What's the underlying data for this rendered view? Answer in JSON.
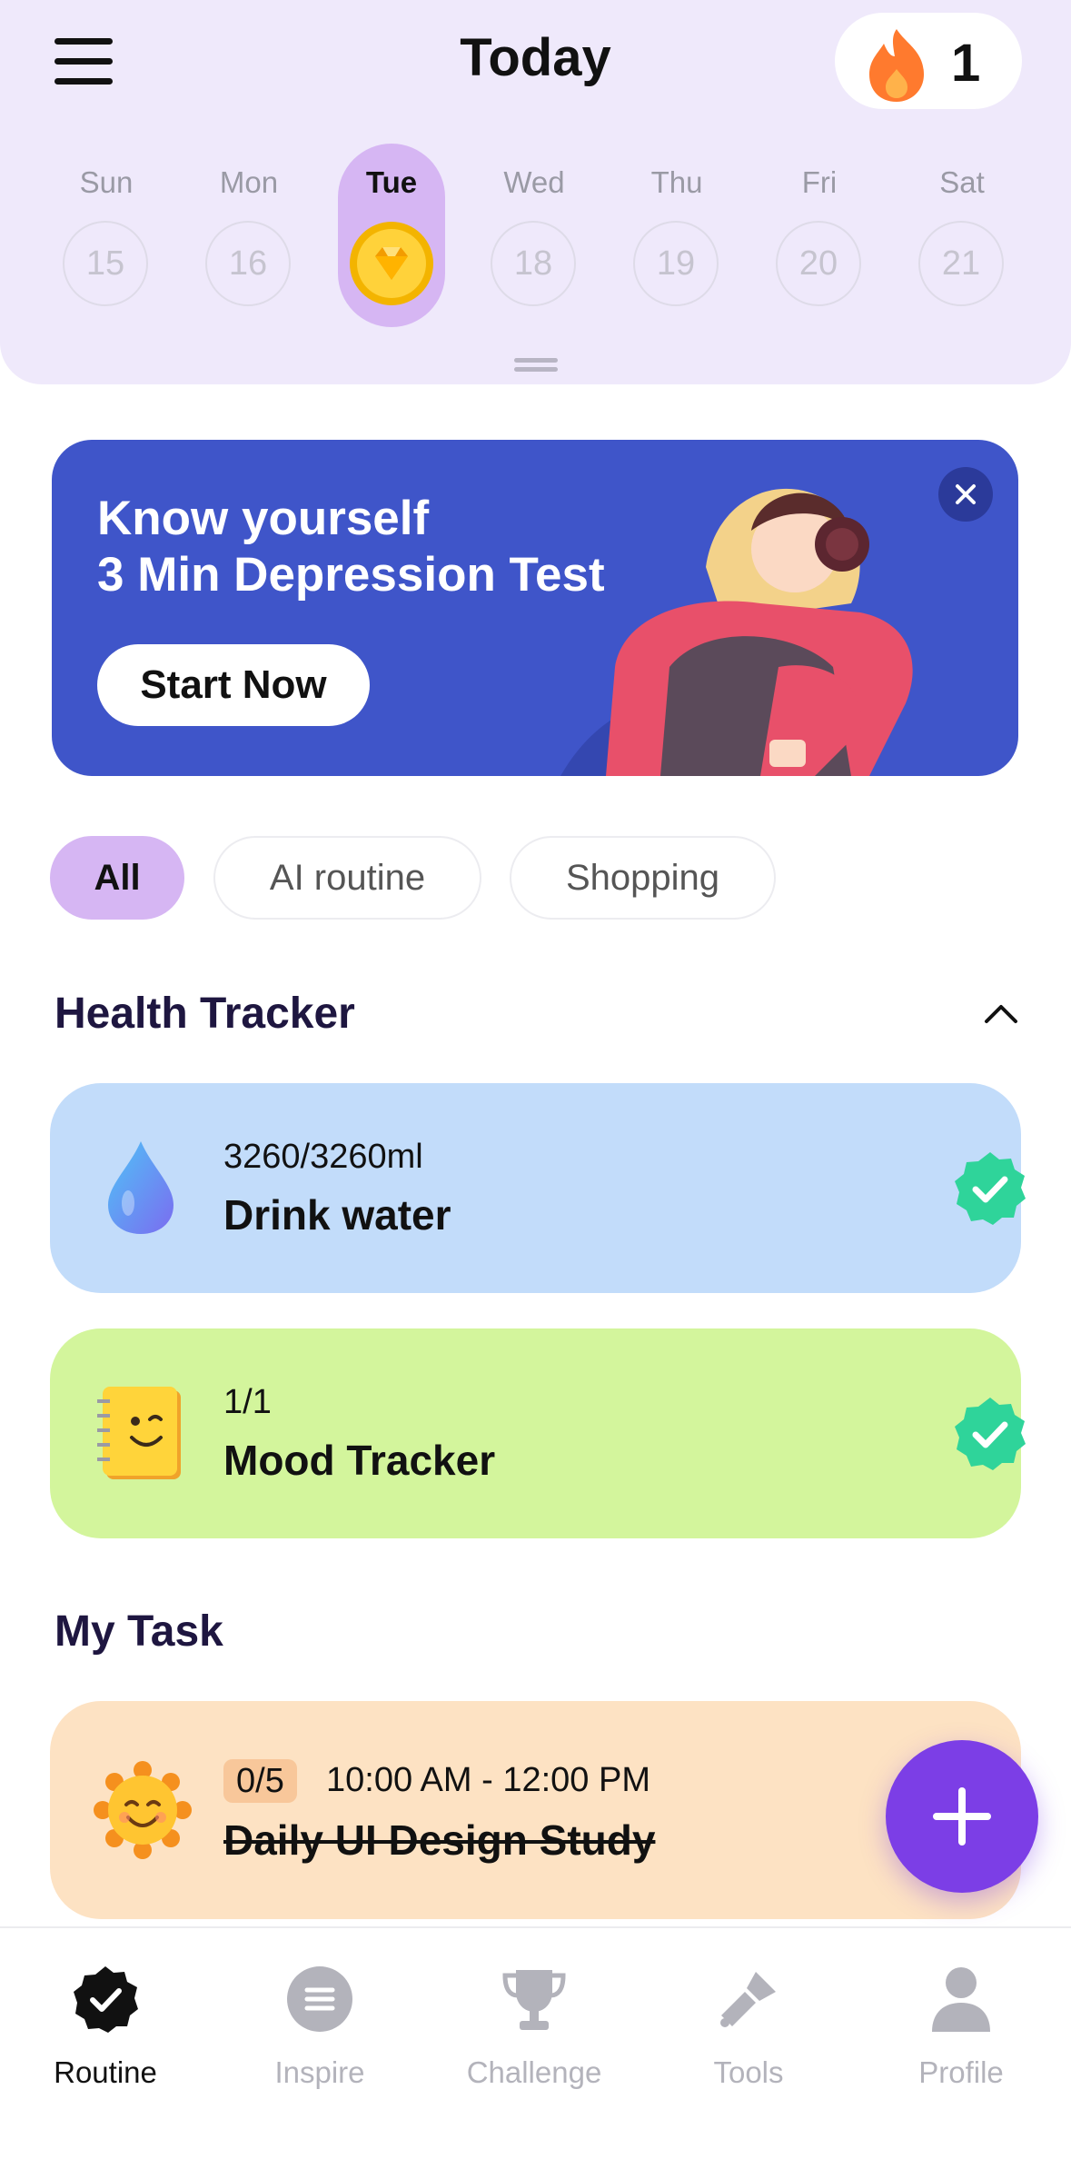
{
  "header": {
    "title": "Today",
    "streak_count": "1",
    "icons": {
      "menu": "menu-icon",
      "streak": "flame-icon",
      "active_day": "gem-coin-icon"
    }
  },
  "week": [
    {
      "day": "Sun",
      "date": "15",
      "active": false
    },
    {
      "day": "Mon",
      "date": "16",
      "active": false
    },
    {
      "day": "Tue",
      "date": "",
      "active": true
    },
    {
      "day": "Wed",
      "date": "18",
      "active": false
    },
    {
      "day": "Thu",
      "date": "19",
      "active": false
    },
    {
      "day": "Fri",
      "date": "20",
      "active": false
    },
    {
      "day": "Sat",
      "date": "21",
      "active": false
    }
  ],
  "banner": {
    "line1": "Know yourself",
    "line2": "3 Min Depression Test",
    "cta": "Start Now",
    "background": "#3f55c9"
  },
  "filters": [
    "All",
    "AI routine",
    "Shopping"
  ],
  "health": {
    "title": "Health Tracker",
    "items": [
      {
        "progress": "3260/3260ml",
        "name": "Drink water",
        "icon": "water-drop-icon",
        "color": "#c2dcfa",
        "done": true
      },
      {
        "progress": "1/1",
        "name": "Mood Tracker",
        "icon": "notebook-emoji-icon",
        "color": "#d3f59c",
        "done": true
      }
    ]
  },
  "tasks": {
    "title": "My Task",
    "items": [
      {
        "badge": "0/5",
        "time": "10:00 AM - 12:00 PM",
        "name": "Daily UI Design Study",
        "icon": "sun-smile-icon",
        "color": "#fde2c3"
      }
    ]
  },
  "nav": [
    "Routine",
    "Inspire",
    "Challenge",
    "Tools",
    "Profile"
  ],
  "colors": {
    "accent": "#7c3ee6",
    "chip_active": "#d6b6f3",
    "check": "#2fd49a"
  }
}
